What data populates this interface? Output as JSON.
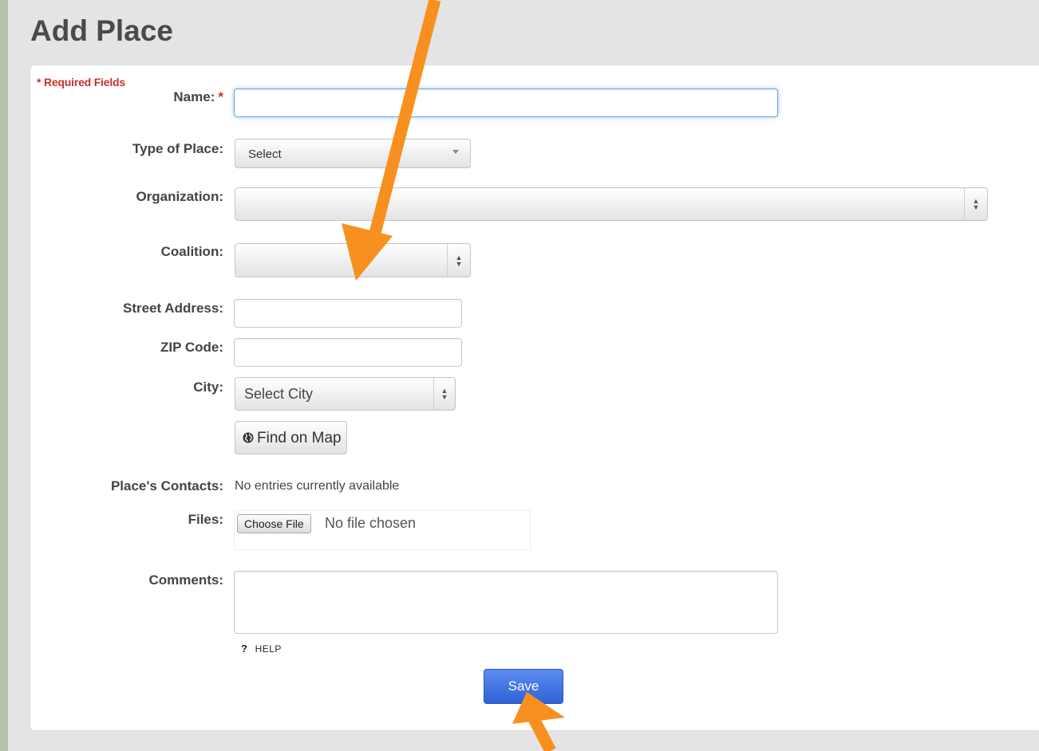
{
  "page_title": "Add Place",
  "required_note": "* Required Fields",
  "colors": {
    "outer_background": "#b5c4a9",
    "required_red": "#c9302c",
    "save_button_blue": "#2f62d8",
    "annotation_arrow": "#f7901e"
  },
  "form": {
    "name": {
      "label": "Name:",
      "required_marker": "*",
      "value": ""
    },
    "type_of_place": {
      "label": "Type of Place:",
      "selected": "Select"
    },
    "organization": {
      "label": "Organization:",
      "selected": ""
    },
    "coalition": {
      "label": "Coalition:",
      "selected": ""
    },
    "street_address": {
      "label": "Street Address:",
      "value": ""
    },
    "zip_code": {
      "label": "ZIP Code:",
      "value": ""
    },
    "city": {
      "label": "City:",
      "selected": "Select City"
    },
    "find_on_map": {
      "label": "Find on Map",
      "icon": "globe-icon"
    },
    "place_contacts": {
      "label": "Place's Contacts:",
      "text": "No entries currently available"
    },
    "files": {
      "label": "Files:",
      "button": "Choose File",
      "status": "No file chosen"
    },
    "comments": {
      "label": "Comments:",
      "value": ""
    },
    "help": {
      "icon": "?",
      "label": "HELP"
    },
    "save": {
      "label": "Save"
    }
  }
}
